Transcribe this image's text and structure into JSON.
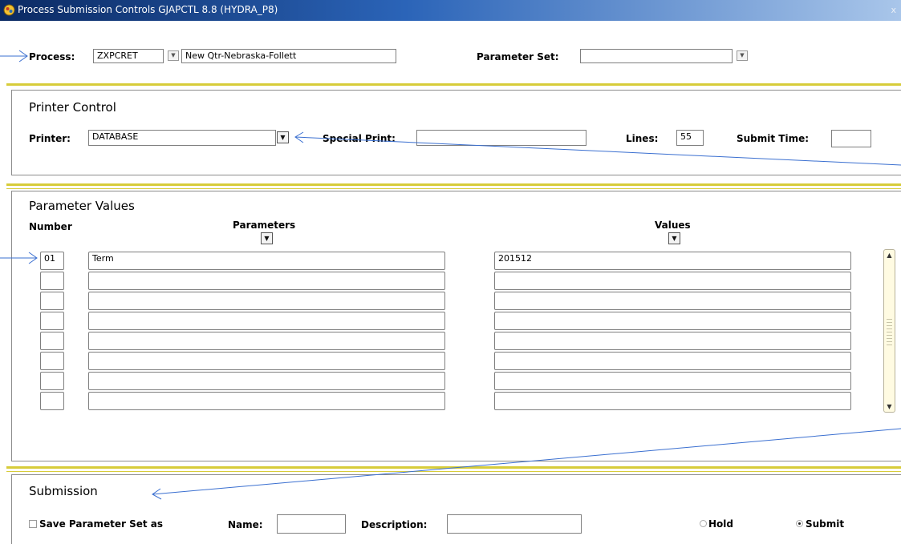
{
  "window": {
    "title": "Process Submission Controls  GJAPCTL  8.8  (HYDRA_P8)",
    "close_glyph": "x"
  },
  "process": {
    "label": "Process:",
    "code": "ZXPCRET",
    "description": "New Qtr-Nebraska-Follett",
    "parameter_set_label": "Parameter Set:",
    "parameter_set_value": ""
  },
  "printer_control": {
    "heading": "Printer Control",
    "printer_label": "Printer:",
    "printer_value": "DATABASE",
    "special_print_label": "Special Print:",
    "special_print_value": "",
    "lines_label": "Lines:",
    "lines_value": "55",
    "submit_time_label": "Submit Time:",
    "submit_time_value": ""
  },
  "parameter_values": {
    "heading": "Parameter Values",
    "number_header": "Number",
    "parameters_header": "Parameters",
    "values_header": "Values",
    "rows": [
      {
        "number": "01",
        "parameter": "Term",
        "value": "201512"
      },
      {
        "number": "",
        "parameter": "",
        "value": ""
      },
      {
        "number": "",
        "parameter": "",
        "value": ""
      },
      {
        "number": "",
        "parameter": "",
        "value": ""
      },
      {
        "number": "",
        "parameter": "",
        "value": ""
      },
      {
        "number": "",
        "parameter": "",
        "value": ""
      },
      {
        "number": "",
        "parameter": "",
        "value": ""
      },
      {
        "number": "",
        "parameter": "",
        "value": ""
      }
    ]
  },
  "submission": {
    "heading": "Submission",
    "save_label": "Save Parameter Set as",
    "name_label": "Name:",
    "name_value": "",
    "description_label": "Description:",
    "description_value": "",
    "hold_label": "Hold",
    "submit_label": "Submit",
    "selected": "Submit"
  },
  "colors": {
    "accent_bar": "#d7cc3a",
    "title_bar": "#2b64b8",
    "annotation_arrow": "#3a6fd0"
  }
}
